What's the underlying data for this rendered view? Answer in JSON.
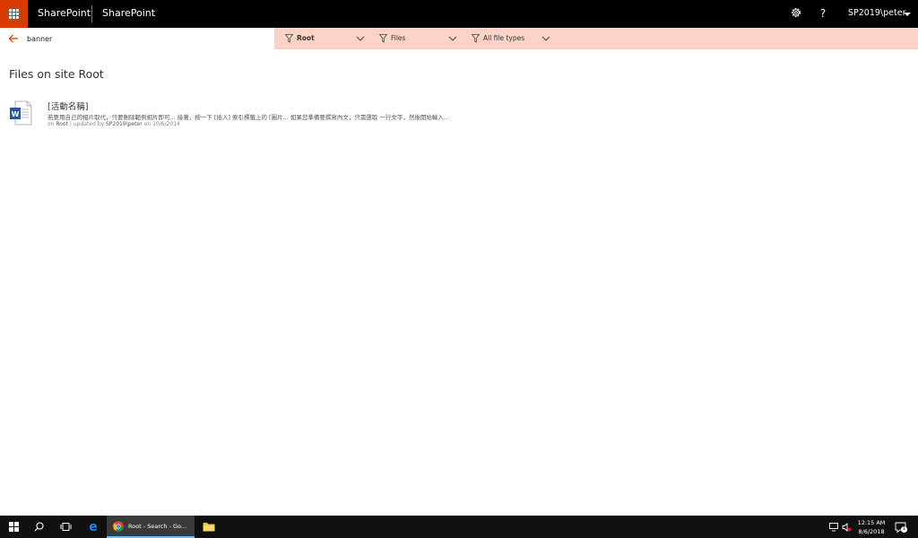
{
  "suite_bar": {
    "app_name": "SharePoint",
    "site_title": "SharePoint",
    "settings_icon": "gear-icon",
    "help_label": "?",
    "user_name": "SP2019\\peter",
    "waffle_color": "#d83b01"
  },
  "search": {
    "query": "banner",
    "filters": [
      {
        "label": "Root"
      },
      {
        "label": "Files"
      },
      {
        "label": "All file types"
      }
    ],
    "accent_color": "#fdd3c7"
  },
  "main": {
    "heading": "Files on site Root",
    "results": [
      {
        "title": "[活動名稱]",
        "summary": "若要用自己的相片取代，只要刪除範例相片即可... 接著，按一下 [插入] 索引標籤上的 [圖片... 如果您準備要撰寫內文，只需選取 一行文字，然後開始輸入...",
        "meta_prefix": "on",
        "site": "Root",
        "meta_mid": "| updated by",
        "author": "SP2019\\peter",
        "meta_on": "on",
        "date": "10/6/2014",
        "icon": "word-document-icon"
      }
    ]
  },
  "taskbar": {
    "active_task_label": "Root - Search - Go...",
    "time": "12:15 AM",
    "date": "8/6/2018",
    "notification_count": "1"
  }
}
